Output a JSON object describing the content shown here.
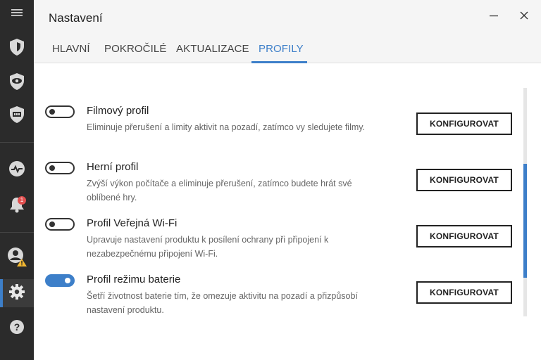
{
  "window": {
    "title": "Nastavení",
    "minimize_icon": "minimize-icon",
    "close_icon": "close-icon"
  },
  "tabs": [
    {
      "label": "HLAVNÍ",
      "active": false
    },
    {
      "label": "POKROČILÉ",
      "active": false
    },
    {
      "label": "AKTUALIZACE",
      "active": false
    },
    {
      "label": "PROFILY",
      "active": true
    }
  ],
  "sidebar": {
    "items": [
      {
        "icon": "hamburger-menu-icon"
      },
      {
        "icon": "shield-icon"
      },
      {
        "icon": "eye-shield-icon"
      },
      {
        "icon": "tv-shield-icon"
      },
      {
        "icon": "activity-pulse-icon"
      },
      {
        "icon": "bell-icon",
        "badge": "1"
      },
      {
        "icon": "account-warning-icon"
      },
      {
        "icon": "gear-icon",
        "active": true
      },
      {
        "icon": "help-icon"
      }
    ]
  },
  "profiles": [
    {
      "title": "Filmový profil",
      "description": "Eliminuje přerušení a limity aktivit na pozadí, zatímco vy sledujete filmy.",
      "enabled": false,
      "button": "KONFIGUROVAT"
    },
    {
      "title": "Herní profil",
      "description": "Zvýší výkon počítače a eliminuje přerušení, zatímco budete hrát své oblíbené hry.",
      "enabled": false,
      "button": "KONFIGUROVAT"
    },
    {
      "title": "Profil Veřejná Wi-Fi",
      "description": "Upravuje nastavení produktu k posílení ochrany při připojení k nezabezpečnému připojení Wi-Fi.",
      "enabled": false,
      "button": "KONFIGUROVAT"
    },
    {
      "title": "Profil režimu baterie",
      "description": "Šetří životnost baterie tím, že omezuje aktivitu na pozadí a přizpůsobí nastavení produktu.",
      "enabled": true,
      "button": "KONFIGUROVAT"
    }
  ],
  "colors": {
    "accent": "#3d7fc9",
    "sidebar_bg": "#2b2b2b",
    "badge": "#e35050",
    "warning": "#f2b731"
  }
}
